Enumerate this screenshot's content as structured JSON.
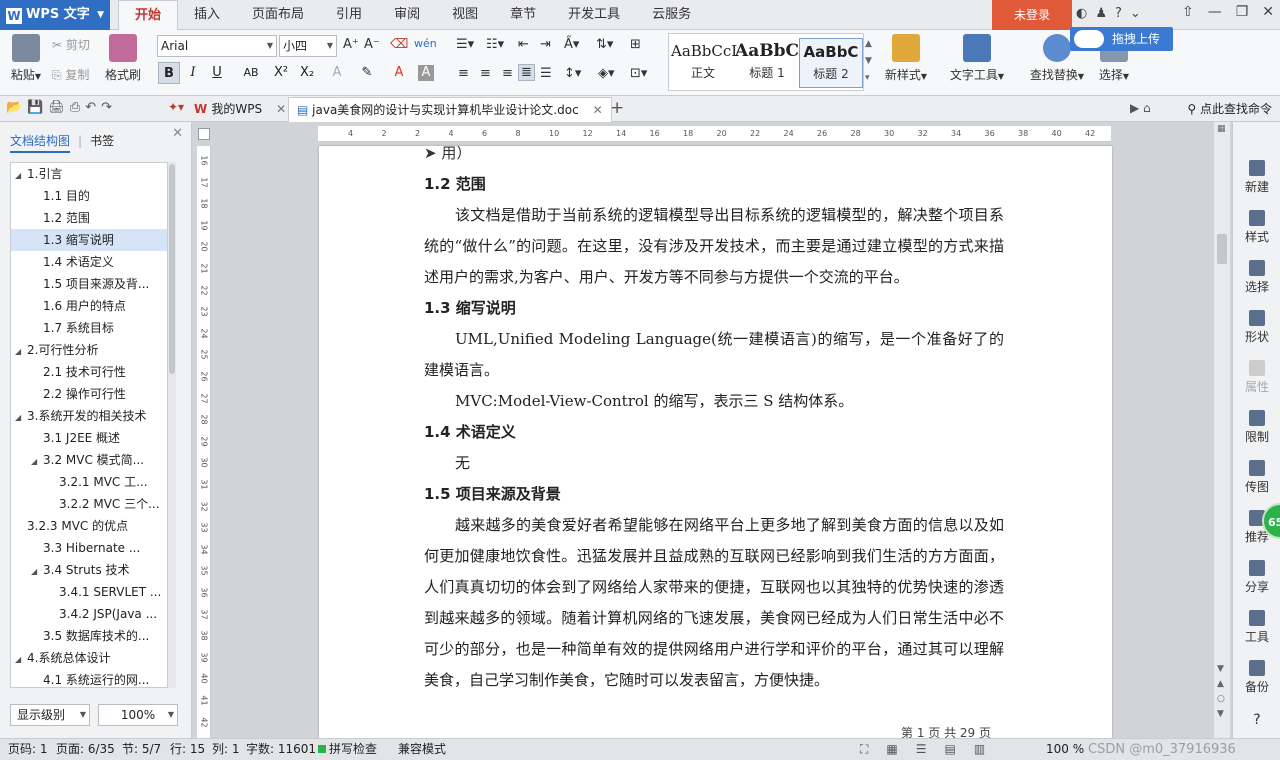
{
  "app": {
    "logo_text": "WPS 文字",
    "login_label": "未登录"
  },
  "tabs": [
    "开始",
    "插入",
    "页面布局",
    "引用",
    "审阅",
    "视图",
    "章节",
    "开发工具",
    "云服务"
  ],
  "ribbon": {
    "paste": "粘贴",
    "cut": "剪切",
    "copy": "复制",
    "format_painter": "格式刷",
    "font_name": "Arial",
    "font_size": "小四",
    "styles": [
      {
        "preview": "AaBbCcI",
        "label": "正文"
      },
      {
        "preview": "AaBbC",
        "label": "标题 1"
      },
      {
        "preview": "AaBbC",
        "label": "标题 2"
      }
    ],
    "new_style": "新样式",
    "text_tool": "文字工具",
    "find_replace": "查找替换",
    "select": "选择",
    "upload": "拖拽上传"
  },
  "quickbar": {
    "tab_mywps": "我的WPS",
    "tab_doc": "java美食网的设计与实现计算机毕业设计论文.doc",
    "find_cmd": "点此查找命令"
  },
  "nav": {
    "tab_outline": "文档结构图",
    "tab_bookmark": "书签",
    "items": [
      {
        "text": "1.引言",
        "level": 0,
        "arrow": "◢"
      },
      {
        "text": "1.1 目的",
        "level": 1,
        "arrow": ""
      },
      {
        "text": "1.2 范围",
        "level": 1,
        "arrow": ""
      },
      {
        "text": "1.3 缩写说明",
        "level": 1,
        "arrow": ""
      },
      {
        "text": "1.4 术语定义",
        "level": 1,
        "arrow": ""
      },
      {
        "text": "1.5 项目来源及背...",
        "level": 1,
        "arrow": ""
      },
      {
        "text": "1.6 用户的特点",
        "level": 1,
        "arrow": ""
      },
      {
        "text": "1.7 系统目标",
        "level": 1,
        "arrow": ""
      },
      {
        "text": "2.可行性分析",
        "level": 0,
        "arrow": "◢"
      },
      {
        "text": "2.1 技术可行性",
        "level": 1,
        "arrow": ""
      },
      {
        "text": "2.2 操作可行性",
        "level": 1,
        "arrow": ""
      },
      {
        "text": "3.系统开发的相关技术",
        "level": 0,
        "arrow": "◢"
      },
      {
        "text": "3.1   J2EE 概述",
        "level": 1,
        "arrow": ""
      },
      {
        "text": "3.2    MVC 模式简...",
        "level": 1,
        "arrow": "◢"
      },
      {
        "text": "3.2.1 MVC 工...",
        "level": 2,
        "arrow": ""
      },
      {
        "text": "3.2.2 MVC 三个...",
        "level": 2,
        "arrow": ""
      },
      {
        "text": "3.2.3 MVC 的优点",
        "level": 0,
        "arrow": ""
      },
      {
        "text": "3.3    Hibernate ...",
        "level": 1,
        "arrow": ""
      },
      {
        "text": "3.4    Struts 技术",
        "level": 1,
        "arrow": "◢"
      },
      {
        "text": "3.4.1 SERVLET ...",
        "level": 2,
        "arrow": ""
      },
      {
        "text": "3.4.2 JSP(Java ...",
        "level": 2,
        "arrow": ""
      },
      {
        "text": "3.5    数据库技术的...",
        "level": 1,
        "arrow": ""
      },
      {
        "text": "4.系统总体设计",
        "level": 0,
        "arrow": "◢"
      },
      {
        "text": "4.1 系统运行的网...",
        "level": 1,
        "arrow": ""
      }
    ],
    "selected_index": 3,
    "display_level": "显示级别",
    "zoom": "100%"
  },
  "ruler_left": [
    "16",
    "17",
    "18",
    "19",
    "20",
    "21",
    "22",
    "23",
    "24",
    "25",
    "26",
    "27",
    "28",
    "29",
    "30",
    "31",
    "32",
    "33",
    "34",
    "35",
    "36",
    "37",
    "38",
    "39",
    "40",
    "41",
    "42",
    "43"
  ],
  "ruler_top": [
    "4",
    "2",
    "2",
    "4",
    "6",
    "8",
    "10",
    "12",
    "14",
    "16",
    "18",
    "20",
    "22",
    "24",
    "26",
    "28",
    "30",
    "32",
    "34",
    "36",
    "38",
    "40",
    "42"
  ],
  "document": {
    "first_line": "➤   用）",
    "blocks": [
      {
        "type": "h",
        "text": "1.2 范围"
      },
      {
        "type": "p",
        "text": "该文档是借助于当前系统的逻辑模型导出目标系统的逻辑模型的，解决整个项目系统的“做什么”的问题。在这里，没有涉及开发技术，而主要是通过建立模型的方式来描述用户的需求,为客户、用户、开发方等不同参与方提供一个交流的平台。"
      },
      {
        "type": "h",
        "text": "1.3 缩写说明"
      },
      {
        "type": "p",
        "text": "UML,Unified Modeling Language(统一建模语言)的缩写，是一个准备好了的建模语言。"
      },
      {
        "type": "p",
        "text": "MVC:Model-View-Control 的缩写，表示三 S 结构体系。"
      },
      {
        "type": "h",
        "text": "1.4 术语定义"
      },
      {
        "type": "p",
        "text": "无"
      },
      {
        "type": "h",
        "text": "1.5 项目来源及背景"
      },
      {
        "type": "p",
        "text": "越来越多的美食爱好者希望能够在网络平台上更多地了解到美食方面的信息以及如何更加健康地饮食性。迅猛发展并且益成熟的互联网已经影响到我们生活的方方面面，人们真真切切的体会到了网络给人家带来的便捷，互联网也以其独特的优势快速的渗透到越来越多的领域。随着计算机网络的飞速发展，美食网已经成为人们日常生活中必不可少的部分，也是一种简单有效的提供网络用户进行学和评价的平台，通过其可以理解美食，自己学习制作美食，它随时可以发表留言，方便快捷。"
      }
    ],
    "footer": "第 1 页 共 29 页"
  },
  "right_tools": [
    {
      "label": "新建",
      "disabled": false
    },
    {
      "label": "样式",
      "disabled": false
    },
    {
      "label": "选择",
      "disabled": false
    },
    {
      "label": "形状",
      "disabled": false
    },
    {
      "label": "属性",
      "disabled": true
    },
    {
      "label": "限制",
      "disabled": false
    },
    {
      "label": "传图",
      "disabled": false
    },
    {
      "label": "推荐",
      "disabled": false
    },
    {
      "label": "分享",
      "disabled": false
    },
    {
      "label": "工具",
      "disabled": false
    },
    {
      "label": "备份",
      "disabled": false
    }
  ],
  "badge": "65",
  "status": {
    "page_code": "页码: 1",
    "page": "页面: 6/35",
    "section": "节: 5/7",
    "row": "行: 15",
    "col": "列: 1",
    "words": "字数: 11601",
    "spell": "拼写检查",
    "compat": "兼容模式",
    "zoom": "100 %",
    "watermark": "CSDN @m0_37916936"
  }
}
